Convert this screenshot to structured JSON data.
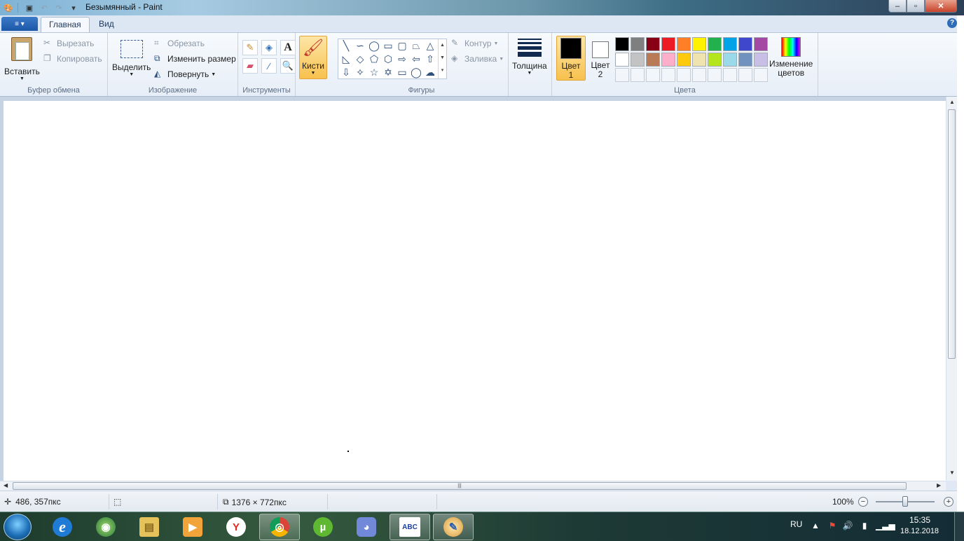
{
  "window": {
    "title": "Безымянный - Paint",
    "minimize": "‒",
    "maximize": "▫",
    "close": "✕"
  },
  "tabs": {
    "file_icon": "≡ ▾",
    "home": "Главная",
    "view": "Вид",
    "help": "?"
  },
  "clipboard": {
    "paste": "Вставить",
    "cut": "Вырезать",
    "copy": "Копировать",
    "label": "Буфер обмена"
  },
  "image": {
    "select": "Выделить",
    "crop": "Обрезать",
    "resize": "Изменить размер",
    "rotate": "Повернуть",
    "label": "Изображение"
  },
  "tools": {
    "label": "Инструменты",
    "text_glyph": "A"
  },
  "brushes": {
    "label": "Кисти"
  },
  "shapes": {
    "outline": "Контур",
    "fill": "Заливка",
    "label": "Фигуры"
  },
  "size": {
    "label": "Толщина"
  },
  "colors": {
    "color1_line1": "Цвет",
    "color1_line2": "1",
    "color2_line1": "Цвет",
    "color2_line2": "2",
    "edit_line1": "Изменение",
    "edit_line2": "цветов",
    "label": "Цвета",
    "color1_value": "#000000",
    "color2_value": "#ffffff",
    "palette_row1": [
      "#000000",
      "#7f7f7f",
      "#880015",
      "#ed1c24",
      "#ff7f27",
      "#fff200",
      "#22b14c",
      "#00a2e8",
      "#3f48cc",
      "#a349a4"
    ],
    "palette_row2": [
      "#ffffff",
      "#c3c3c3",
      "#b97a57",
      "#ffaec9",
      "#ffc90e",
      "#efe4b0",
      "#b5e61d",
      "#99d9ea",
      "#7092be",
      "#c8bfe7"
    ]
  },
  "status": {
    "cursor_pos": "486, 357пкс",
    "image_size": "1376 × 772пкс",
    "zoom": "100%",
    "zoom_out": "−",
    "zoom_in": "+"
  },
  "taskbar": {
    "lang": "RU",
    "time": "15:35",
    "date": "18.12.2018",
    "apps": [
      {
        "name": "internet-explorer",
        "glyph": "e"
      },
      {
        "name": "media-center",
        "glyph": "◉"
      },
      {
        "name": "file-explorer",
        "glyph": "▤"
      },
      {
        "name": "media-player",
        "glyph": "▶"
      },
      {
        "name": "yandex",
        "glyph": "Y"
      },
      {
        "name": "chrome",
        "glyph": "◎"
      },
      {
        "name": "utorrent",
        "glyph": "µ"
      },
      {
        "name": "discord",
        "glyph": "◕"
      },
      {
        "name": "abc-net",
        "glyph": "ABC"
      },
      {
        "name": "paint",
        "glyph": "✎"
      }
    ]
  }
}
